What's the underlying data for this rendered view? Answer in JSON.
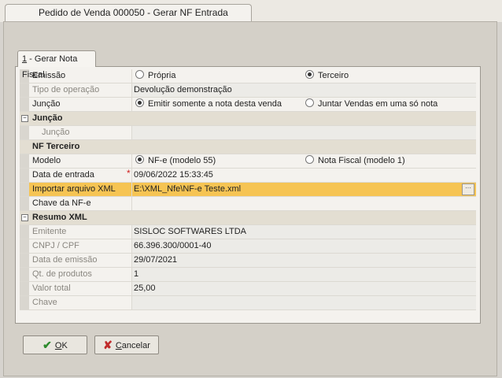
{
  "window": {
    "title": "Pedido de Venda 000050 - Gerar NF Entrada"
  },
  "tab": {
    "number": "1",
    "label": " - Gerar Nota Fiscal"
  },
  "rows": {
    "emissao": {
      "label": "Emissão",
      "opt1": "Própria",
      "opt2": "Terceiro"
    },
    "tipo_operacao": {
      "label": "Tipo de operação",
      "value": "Devolução demonstração"
    },
    "juncao": {
      "label": "Junção",
      "opt1": "Emitir somente a nota desta venda",
      "opt2": "Juntar Vendas em uma só nota"
    }
  },
  "sections": {
    "juncao": {
      "title": "Junção",
      "field_label": "Junção",
      "value": ""
    },
    "nf_terceiro": {
      "title": "NF Terceiro",
      "modelo_label": "Modelo",
      "modelo_opt1": "NF-e (modelo 55)",
      "modelo_opt2": "Nota Fiscal (modelo 1)",
      "data_entrada_label": "Data de entrada",
      "data_entrada_value": "09/06/2022 15:33:45",
      "importar_label": "Importar arquivo XML",
      "importar_value": "E:\\XML_Nfe\\NF-e Teste.xml",
      "chave_label": "Chave da NF-e",
      "chave_value": ""
    },
    "resumo": {
      "title": "Resumo XML",
      "emitente_label": "Emitente",
      "emitente_value": "SISLOC SOFTWARES LTDA",
      "cnpj_label": "CNPJ / CPF",
      "cnpj_value": "66.396.300/0001-40",
      "data_emissao_label": "Data de emissão",
      "data_emissao_value": "29/07/2021",
      "qt_label": "Qt. de produtos",
      "qt_value": "1",
      "valor_label": "Valor total",
      "valor_value": "25,00",
      "chave_label": "Chave",
      "chave_value": ""
    }
  },
  "buttons": {
    "ok_first": "O",
    "ok_rest": "K",
    "cancel_first": "C",
    "cancel_rest": "ancelar"
  },
  "icons": {
    "collapse": "minus-icon",
    "ok": "check-icon",
    "cancel": "x-icon",
    "browse": "ellipsis-icon"
  },
  "colors": {
    "highlight": "#f6c453",
    "section": "#e3ded2",
    "ok_icon": "#2e8b2e",
    "cancel_icon": "#c02b2b"
  }
}
